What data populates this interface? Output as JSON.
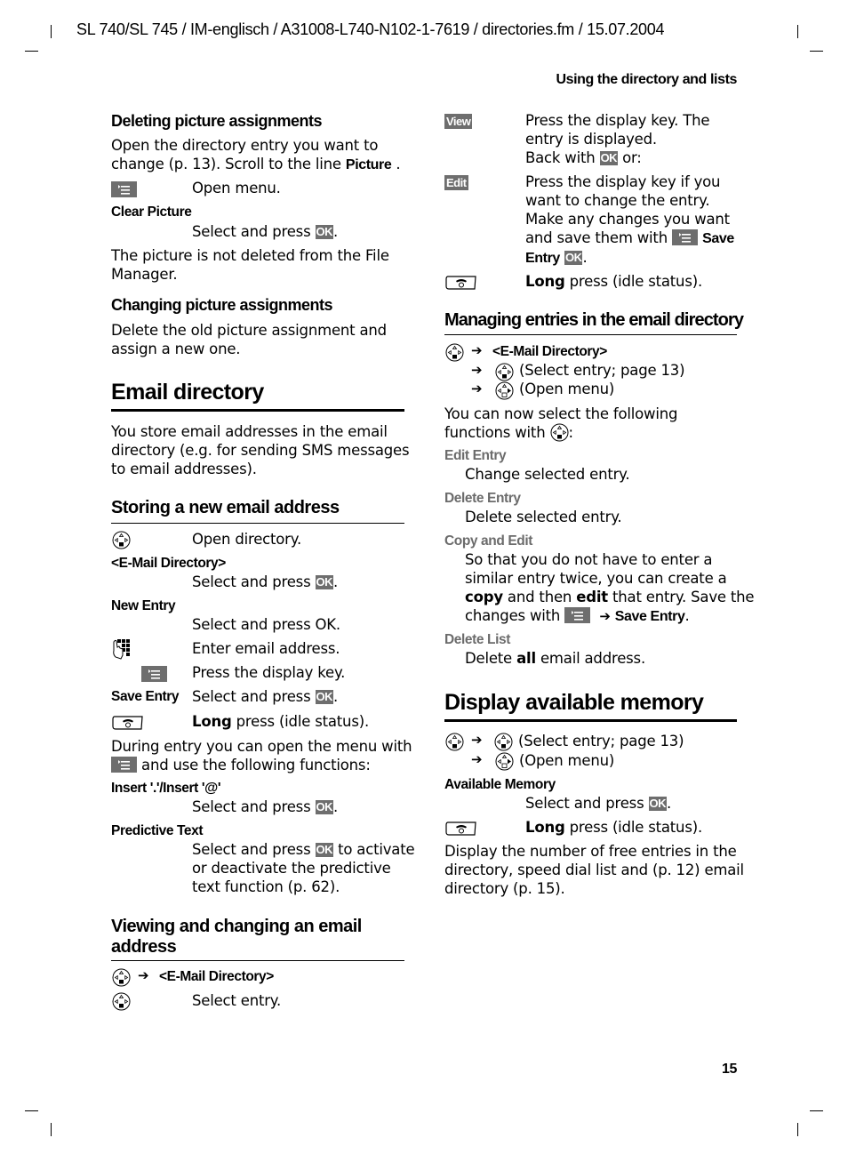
{
  "header": {
    "doc_info": "SL 740/SL 745 / IM-englisch / A31008-L740-N102-1-7619 / directories.fm / 15.07.2004",
    "running_head": "Using the directory and lists"
  },
  "footer": {
    "page_number": "15"
  },
  "keys": {
    "ok": "OK",
    "view": "View",
    "edit": "Edit"
  },
  "left": {
    "deleting": {
      "heading": "Deleting picture assignments",
      "intro_1": "Open the directory entry you want to",
      "intro_2a": "change (p. 13). Scroll to the line ",
      "intro_2b": "Picture",
      "intro_2c": " .",
      "open_menu": "Open menu.",
      "clear_picture": "Clear Picture",
      "select_press": "Select and press ",
      "note_1": "The picture is not deleted from the File",
      "note_2": "Manager."
    },
    "changing": {
      "heading": "Changing picture assignments",
      "text_1": "Delete the old picture assignment and",
      "text_2": "assign a new one."
    },
    "email_directory": {
      "heading": "Email directory",
      "text_1": "You store email addresses in the email",
      "text_2": "directory (e.g. for sending SMS messages",
      "text_3": "to email addresses)."
    },
    "storing": {
      "heading": "Storing a new email address",
      "open_directory": "Open directory.",
      "email_dir_label": "<E-Mail Directory>",
      "select_press": "Select and press ",
      "new_entry_label": "New Entry",
      "select_press_ok_plain": "Select and press OK.",
      "enter_email": "Enter email address.",
      "press_display_key": "Press the display key.",
      "save_entry_label": "Save Entry",
      "long": "Long",
      "long_press_rest": " press (idle status).",
      "during_1": "During entry you can open the menu with",
      "during_2": " and use the following functions:",
      "insert_label": "Insert '.'/Insert '@'",
      "predictive_label": "Predictive Text",
      "predictive_1b": " to activate",
      "predictive_2": "or deactivate the predictive",
      "predictive_3": "text function (p. 62)."
    },
    "viewing": {
      "heading_1": "Viewing and changing an email",
      "heading_2": "address",
      "email_dir_label": "<E-Mail Directory>",
      "select_entry": "Select entry."
    }
  },
  "right": {
    "view_1": "Press the display key. The",
    "view_2": "entry is displayed.",
    "view_3a": "Back with ",
    "view_3b": " or:",
    "edit_1": "Press the display key if you",
    "edit_2": "want to change the entry.",
    "edit_3": "Make any changes you want",
    "edit_4": "and save them with ",
    "edit_4b": "Save",
    "edit_5": "Entry",
    "long": "Long",
    "long_press_rest": " press (idle status).",
    "managing": {
      "heading": "Managing entries in the email directory",
      "email_dir_label": "<E-Mail Directory>",
      "select_entry_page": "(Select entry; page 13)",
      "open_menu": "(Open menu)",
      "can_select_1": "You can now select the following",
      "can_select_2": "functions with ",
      "items": [
        {
          "label": "Edit Entry",
          "desc": [
            "Change selected entry."
          ]
        },
        {
          "label": "Delete Entry",
          "desc": [
            "Delete selected entry."
          ]
        },
        {
          "label": "Copy and Edit",
          "desc": [
            "So that you do not have to enter a",
            "similar entry twice, you can create a"
          ]
        },
        {
          "label": "Delete List",
          "desc": []
        }
      ],
      "copy_3a": "copy",
      "copy_3b": " and then ",
      "copy_3c": "edit",
      "copy_3d": " that entry. Save the",
      "copy_4a": "changes with ",
      "copy_4b": "Save Entry",
      "delete_list_a": "Delete ",
      "delete_list_b": "all",
      "delete_list_c": " email address."
    },
    "memory": {
      "heading": "Display available memory",
      "select_entry_page": "(Select entry; page 13)",
      "open_menu": "(Open menu)",
      "available_label": "Available Memory",
      "select_press": "Select and press ",
      "text_1": "Display the number of free entries in the",
      "text_2": "directory, speed dial list and (p. 12) email",
      "text_3": "directory (p. 15)."
    }
  }
}
